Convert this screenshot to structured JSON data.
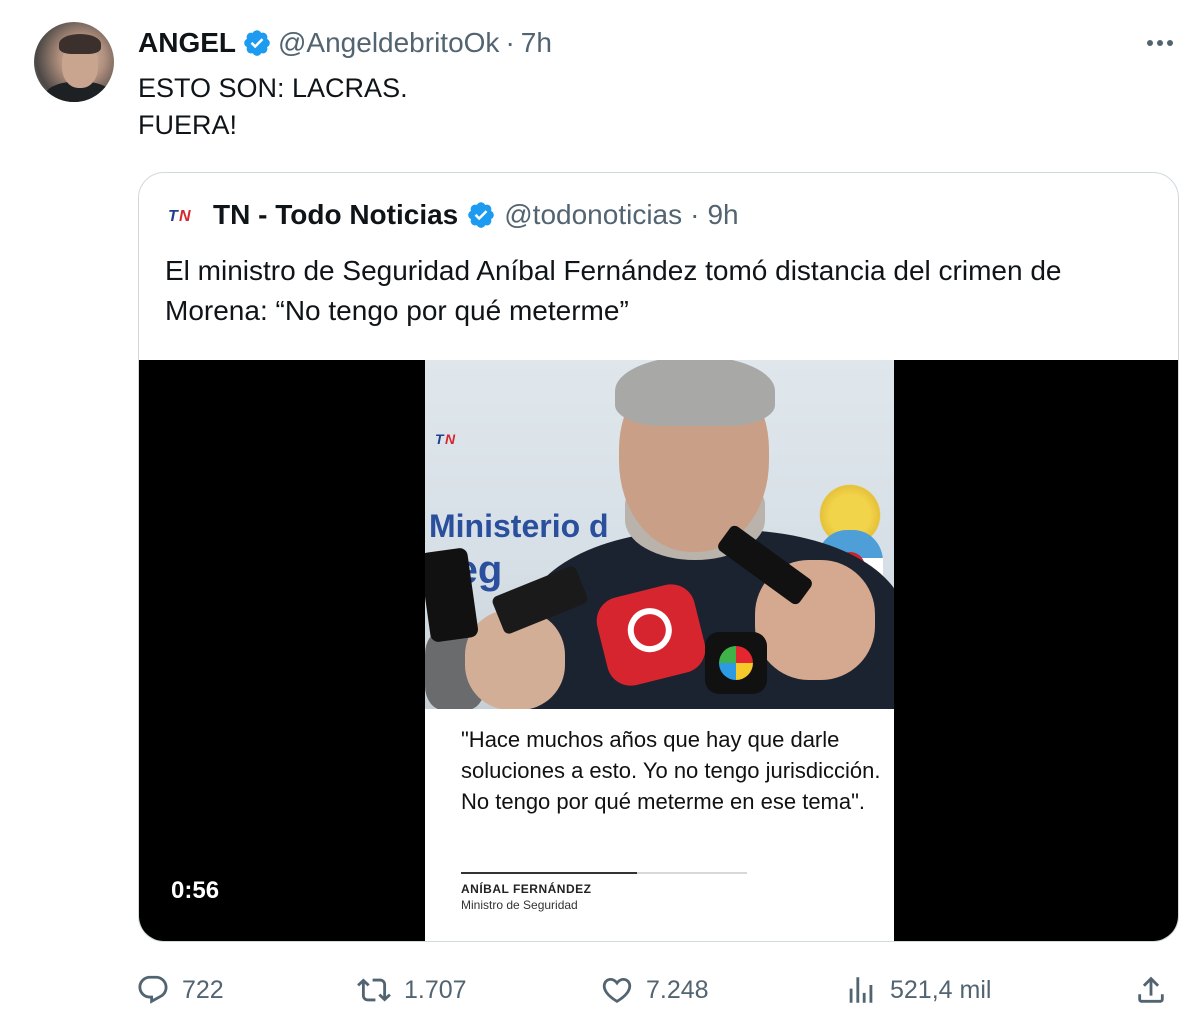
{
  "tweet": {
    "author": {
      "display_name": "ANGEL",
      "handle": "@AngeldebritoOk",
      "separator": "·",
      "time": "7h",
      "verified": true,
      "verified_color": "#1d9bf0"
    },
    "text_lines": [
      "ESTO SON: LACRAS.",
      "FUERA!"
    ],
    "more_icon": "more-horizontal-icon"
  },
  "quote": {
    "author": {
      "display_name": "TN - Todo Noticias",
      "handle": "@todonoticias",
      "separator": "·",
      "time": "9h",
      "verified": true
    },
    "text": "El ministro de Seguridad Aníbal Fernández tomó distancia del crimen de Morena: “No tengo por qué meterme”",
    "media": {
      "duration": "0:56",
      "wall_text_1": "Ministerio d",
      "wall_text_2": "Seg",
      "caption": "\"Hace muchos años que hay que darle soluciones a esto. Yo no tengo jurisdicción. No tengo por qué meterme en ese tema\".",
      "caption_name": "ANÍBAL FERNÁNDEZ",
      "caption_role": "Ministro de Seguridad"
    }
  },
  "actions": {
    "replies": "722",
    "reposts": "1.707",
    "likes": "7.248",
    "views": "521,4 mil"
  },
  "colors": {
    "text": "#0f1419",
    "secondary": "#536471",
    "border": "#cfd9de",
    "accent": "#1d9bf0",
    "media_bg": "#000000"
  }
}
